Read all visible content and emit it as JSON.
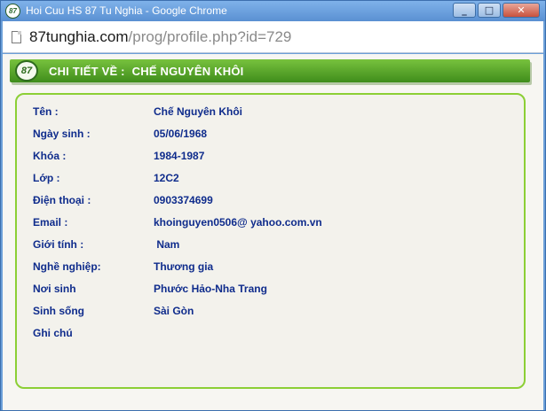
{
  "window": {
    "title": "Hoi Cuu HS 87 Tu Nghia - Google Chrome",
    "app_icon_text": "87",
    "buttons": {
      "minimize": "_",
      "maximize": "□",
      "close": "✕"
    }
  },
  "address": {
    "host": "87tunghia.com",
    "path": "/prog/profile.php?id=729"
  },
  "header": {
    "logo_text": "87",
    "prefix": "CHI TIẾT VỀ :",
    "name": "CHẾ NGUYÊN KHÔI"
  },
  "profile": [
    {
      "label": "Tên :",
      "value": "Chế Nguyên Khôi"
    },
    {
      "label": "Ngày sinh :",
      "value": "05/06/1968"
    },
    {
      "label": "Khóa :",
      "value": "1984-1987"
    },
    {
      "label": "Lớp :",
      "value": "12C2"
    },
    {
      "label": "Điện thoại :",
      "value": "0903374699"
    },
    {
      "label": "Email :",
      "value": "khoinguyen0506@ yahoo.com.vn"
    },
    {
      "label": "Giới tính :",
      "value": " Nam"
    },
    {
      "label": "Nghề nghiệp:",
      "value": "Thương gia"
    },
    {
      "label": "Nơi sinh",
      "value": "Phước Hảo-Nha Trang"
    },
    {
      "label": "Sinh sống",
      "value": "Sài Gòn"
    },
    {
      "label": "Ghi chú",
      "value": ""
    }
  ],
  "colors": {
    "header_green": "#4f9f25",
    "panel_border": "#8ccf35",
    "text_blue": "#0f2c8c"
  }
}
